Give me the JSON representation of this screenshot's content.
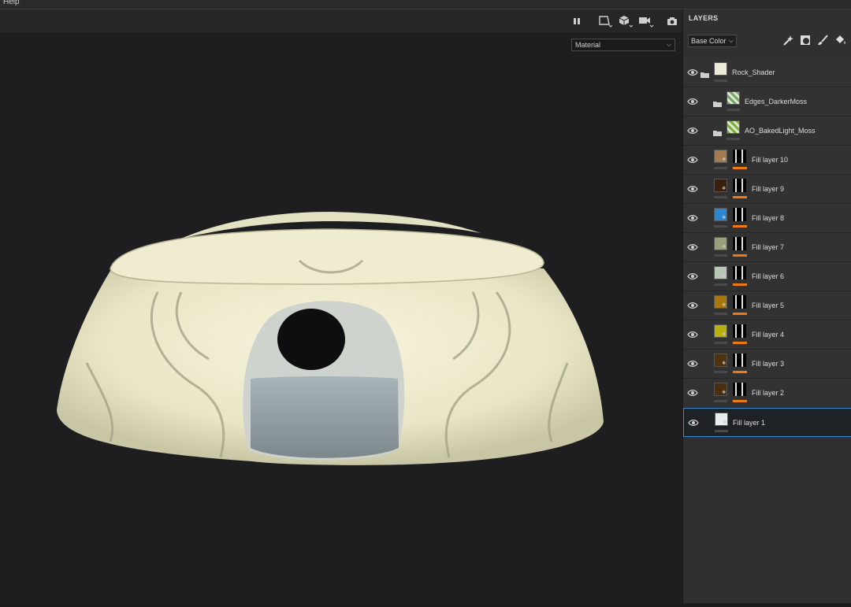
{
  "menubar": {
    "help": "Help"
  },
  "viewport": {
    "material_select": "Material"
  },
  "layers_panel": {
    "title": "LAYERS",
    "channel_select": "Base Color",
    "layers": [
      {
        "name": "Rock_Shader",
        "kind": "group-root",
        "color": "#ecebd8"
      },
      {
        "name": "Edges_DarkerMoss",
        "kind": "group",
        "color": "#7aa86a"
      },
      {
        "name": "AO_BakedLight_Moss",
        "kind": "group",
        "color": "#7fb03a"
      },
      {
        "name": "Fill layer 10",
        "kind": "fill",
        "color": "#a57a4e"
      },
      {
        "name": "Fill layer 9",
        "kind": "fill",
        "color": "#3a1e0e"
      },
      {
        "name": "Fill layer 8",
        "kind": "fill",
        "color": "#2a86d0"
      },
      {
        "name": "Fill layer 7",
        "kind": "fill",
        "color": "#97a07a"
      },
      {
        "name": "Fill layer 6",
        "kind": "fill",
        "color": "#b8c6b4"
      },
      {
        "name": "Fill layer 5",
        "kind": "fill",
        "color": "#a8780e"
      },
      {
        "name": "Fill layer 4",
        "kind": "fill",
        "color": "#b8b00e"
      },
      {
        "name": "Fill layer 3",
        "kind": "fill",
        "color": "#4e340e"
      },
      {
        "name": "Fill layer 2",
        "kind": "fill",
        "color": "#4a300e"
      },
      {
        "name": "Fill layer 1",
        "kind": "fill",
        "color": "#e8eef0",
        "selected": true
      }
    ]
  },
  "colors": {
    "accent_orange": "#f07a12",
    "selection_blue": "#3b8fd6"
  }
}
